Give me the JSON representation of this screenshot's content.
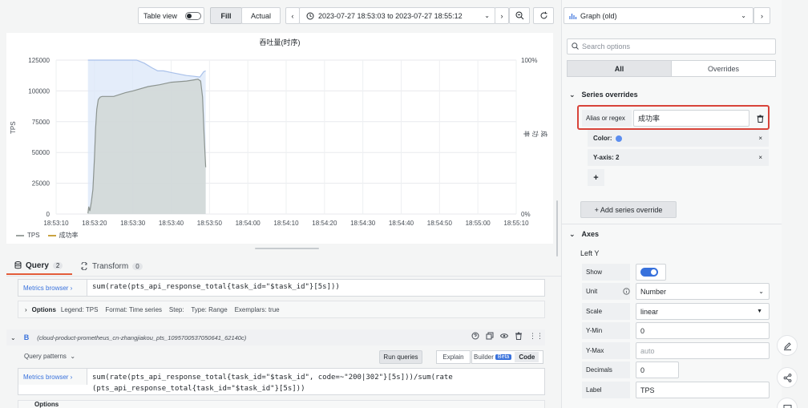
{
  "toolbar": {
    "table_view_label": "Table view",
    "fill_label": "Fill",
    "actual_label": "Actual",
    "time_range": "2023-07-27 18:53:03 to 2023-07-27 18:55:12"
  },
  "chart_data": {
    "type": "line",
    "title": "吞吐量(时序)",
    "ylabel": "TPS",
    "y2label": "成功率",
    "x": [
      "18:53:10",
      "18:53:20",
      "18:53:30",
      "18:53:40",
      "18:53:50",
      "18:54:00",
      "18:54:10",
      "18:54:20",
      "18:54:30",
      "18:54:40",
      "18:54:50",
      "18:55:00",
      "18:55:10"
    ],
    "x_ticks": [
      "18:53:10",
      "18:53:20",
      "18:53:30",
      "18:53:40",
      "18:53:50",
      "18:54:00",
      "18:54:10",
      "18:54:20",
      "18:54:30",
      "18:54:40",
      "18:54:50",
      "18:55:00",
      "18:55:10"
    ],
    "y_ticks": [
      "0",
      "25000",
      "50000",
      "75000",
      "100000",
      "125000"
    ],
    "y2_ticks": [
      "0%",
      "100%"
    ],
    "ylim": [
      0,
      125000
    ],
    "y2lim": [
      0,
      100
    ],
    "series": [
      {
        "name": "TPS",
        "axis": "left",
        "color": "#9ca3a0",
        "points": [
          [
            18.3,
            500
          ],
          [
            18.5,
            6000
          ],
          [
            18.8,
            2500
          ],
          [
            19.2,
            10000
          ],
          [
            19.6,
            20000
          ],
          [
            20.0,
            45000
          ],
          [
            20.3,
            70000
          ],
          [
            20.6,
            85000
          ],
          [
            21.0,
            93000
          ],
          [
            21.5,
            95000
          ],
          [
            22.0,
            95500
          ],
          [
            25.0,
            95500
          ],
          [
            28.0,
            98500
          ],
          [
            30.0,
            100000
          ],
          [
            34.0,
            103500
          ],
          [
            37.0,
            105000
          ],
          [
            40.0,
            107000
          ],
          [
            44.0,
            108000
          ],
          [
            46.0,
            109000
          ],
          [
            47.0,
            109500
          ],
          [
            47.7,
            108000
          ],
          [
            48.2,
            95000
          ],
          [
            48.6,
            65000
          ],
          [
            49.0,
            38000
          ]
        ]
      },
      {
        "name": "成功率",
        "axis": "right",
        "color": "#c9a341",
        "points": [
          [
            18.3,
            100
          ],
          [
            31.0,
            100
          ],
          [
            33.0,
            98
          ],
          [
            35.0,
            95
          ],
          [
            36.5,
            93
          ],
          [
            38.0,
            93
          ],
          [
            40.0,
            92
          ],
          [
            42.0,
            91
          ],
          [
            44.0,
            90
          ],
          [
            46.0,
            89.5
          ],
          [
            47.5,
            89
          ],
          [
            48.5,
            92.5
          ],
          [
            49.0,
            93
          ]
        ]
      }
    ]
  },
  "legend": [
    {
      "label": "TPS",
      "color": "#9ca3a0"
    },
    {
      "label": "成功率",
      "color": "#c9a341"
    }
  ],
  "query_tabs": {
    "query_label": "Query",
    "query_count": "2",
    "transform_label": "Transform",
    "transform_count": "0"
  },
  "query_a": {
    "metrics_browser": "Metrics browser",
    "expr": "sum(rate(pts_api_response_total{task_id=\"$task_id\"}[5s]))",
    "options_label": "Options",
    "options_summary": "Legend: TPS    Format: Time series    Step:    Type: Range    Exemplars: true"
  },
  "query_b": {
    "ref": "B",
    "datasource": "(cloud-product-prometheus_cn-zhangjiakou_pts_1095700537050641_62140c)",
    "query_patterns": "Query patterns",
    "run_queries": "Run queries",
    "explain": "Explain",
    "builder": "Builder",
    "beta": "Beta",
    "code": "Code",
    "metrics_browser": "Metrics browser",
    "expr_line1": "sum(rate(pts_api_response_total{task_id=\"$task_id\", code=~\"200|302\"}[5s]))/sum(rate",
    "expr_line2": "(pts_api_response_total{task_id=\"$task_id\"}[5s]))",
    "options_label": "Options"
  },
  "right_panel": {
    "viz_name": "Graph (old)",
    "search_placeholder": "Search options",
    "tab_all": "All",
    "tab_overrides": "Overrides",
    "series_overrides_title": "Series overrides",
    "alias_label": "Alias or regex",
    "alias_value": "成功率",
    "color_label": "Color:",
    "color_value": "#5b8def",
    "yaxis_label": "Y-axis: 2",
    "add_override": "+ Add series override",
    "axes_title": "Axes",
    "left_y_title": "Left Y",
    "show_label": "Show",
    "unit_label": "Unit",
    "unit_value": "Number",
    "scale_label": "Scale",
    "scale_value": "linear",
    "ymin_label": "Y-Min",
    "ymin_value": "0",
    "ymax_label": "Y-Max",
    "ymax_placeholder": "auto",
    "decimals_label": "Decimals",
    "decimals_value": "0",
    "label_label": "Label",
    "label_value": "TPS"
  }
}
